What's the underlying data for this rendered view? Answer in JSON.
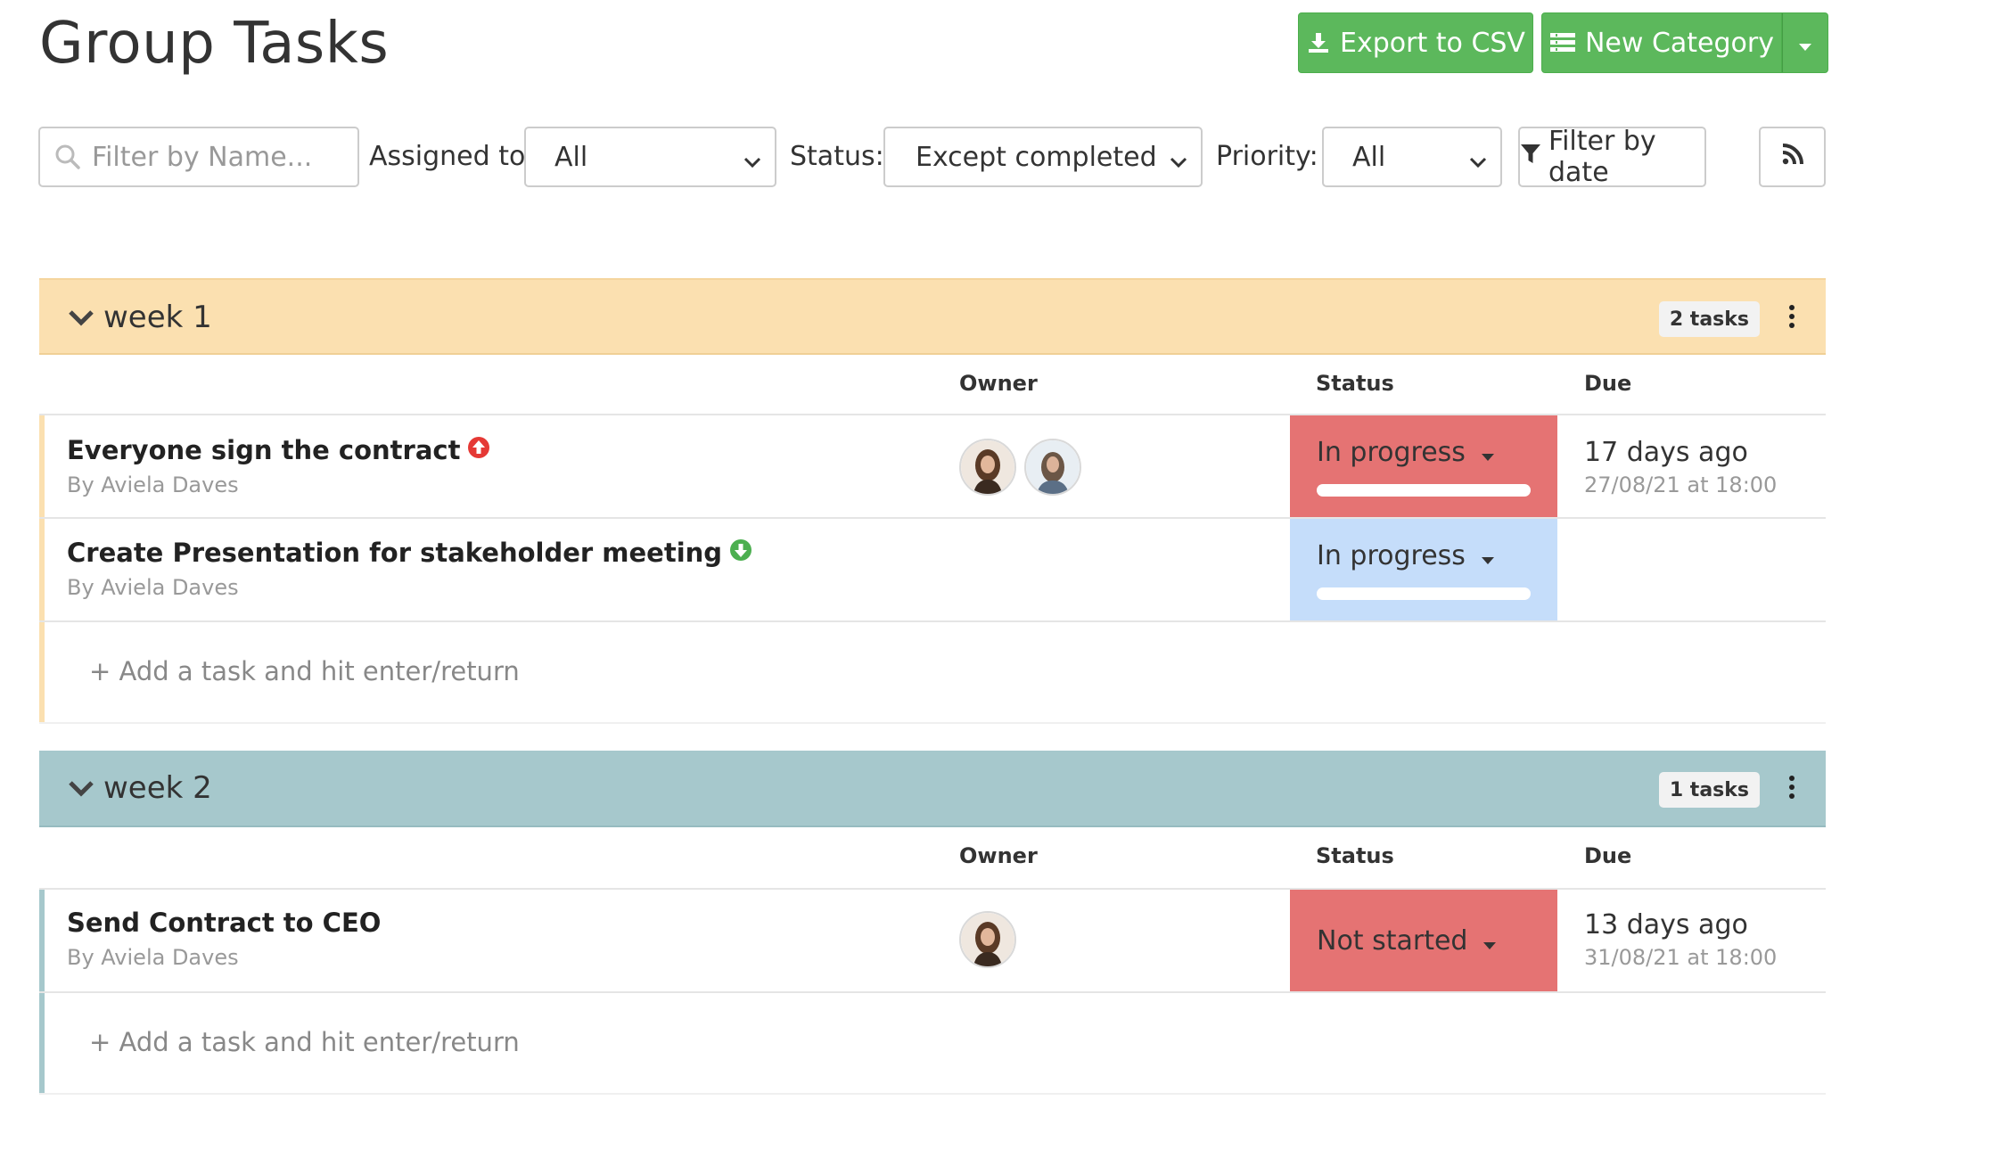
{
  "page": {
    "title": "Group Tasks"
  },
  "toolbar": {
    "export_label": "Export to CSV",
    "new_category_label": "New Category"
  },
  "filters": {
    "name_placeholder": "Filter by Name...",
    "assigned_label": "Assigned to:",
    "assigned_value": "All",
    "status_label": "Status:",
    "status_value": "Except completed",
    "priority_label": "Priority:",
    "priority_value": "All",
    "date_label": "Filter by date"
  },
  "columns": {
    "owner": "Owner",
    "status": "Status",
    "due": "Due"
  },
  "add_task_placeholder": "+ Add a task and hit enter/return",
  "groups": [
    {
      "name": "week 1",
      "count": "2 tasks",
      "color": "#fbe0b0",
      "accent": "#fbe0b0",
      "tasks": [
        {
          "title": "Everyone sign the contract",
          "by": "By Aviela Daves",
          "priority_icon": "priority-up-icon",
          "status": "In progress",
          "status_color": "#e57373",
          "due_relative": "17 days ago",
          "due_absolute": "27/08/21 at 18:00"
        },
        {
          "title": "Create Presentation for stakeholder meeting",
          "by": "By Aviela Daves",
          "priority_icon": "priority-down-icon",
          "status": "In progress",
          "status_color": "#c5ddfa",
          "due_relative": "",
          "due_absolute": ""
        }
      ]
    },
    {
      "name": "week 2",
      "count": "1 tasks",
      "color": "#a6c8cc",
      "accent": "#a6c8cc",
      "tasks": [
        {
          "title": "Send Contract to CEO",
          "by": "By Aviela Daves",
          "status": "Not started",
          "status_color": "#e57373",
          "due_relative": "13 days ago",
          "due_absolute": "31/08/21 at 18:00"
        }
      ]
    }
  ]
}
